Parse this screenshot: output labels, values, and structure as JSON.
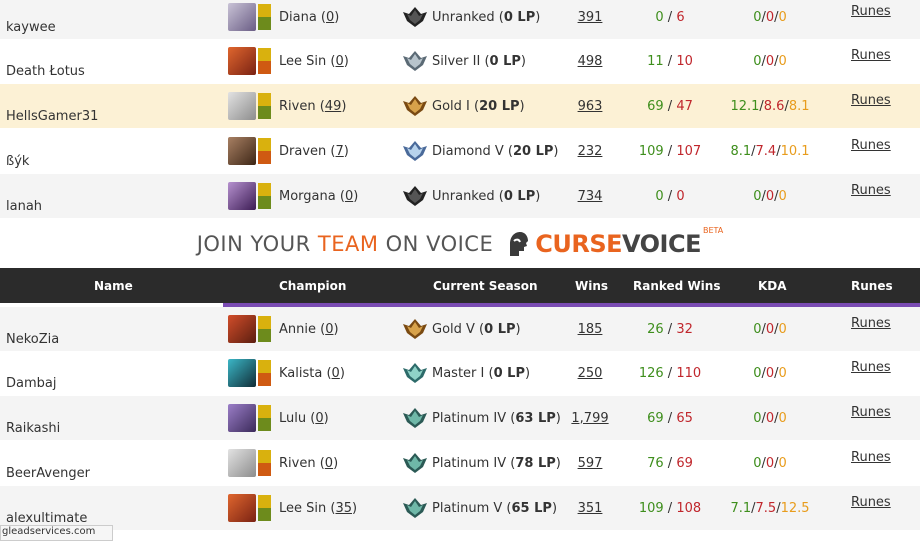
{
  "colors": {
    "wins": "#3e8e1c",
    "losses": "#c0262c",
    "assists": "#e89c1c",
    "banner_accent": "#e9641f",
    "header_bg": "#2b2b2b",
    "highlight": "#fcf1d5",
    "purple_bar": "#7a4bb3"
  },
  "team1": [
    {
      "name": "kaywee",
      "champion": "Diana",
      "champ_games": "0",
      "portrait": "diana-portrait",
      "rank_icon": "unranked-icon",
      "rank": "Unranked",
      "lp": "0 LP",
      "wins": "391",
      "rw": "0",
      "rl": "6",
      "k": "0",
      "d": "0",
      "a": "0",
      "runes": "Runes"
    },
    {
      "name": "Death Łotus",
      "champion": "Lee Sin",
      "champ_games": "0",
      "portrait": "lee-sin-portrait",
      "rank_icon": "silver-icon",
      "rank": "Silver II",
      "lp": "0 LP",
      "wins": "498",
      "rw": "11",
      "rl": "10",
      "k": "0",
      "d": "0",
      "a": "0",
      "runes": "Runes"
    },
    {
      "name": "HellsGamer31",
      "champion": "Riven",
      "champ_games": "49",
      "portrait": "riven-portrait",
      "rank_icon": "gold-icon",
      "rank": "Gold I",
      "lp": "20 LP",
      "wins": "963",
      "rw": "69",
      "rl": "47",
      "k": "12.1",
      "d": "8.6",
      "a": "8.1",
      "runes": "Runes"
    },
    {
      "name": "ßýk",
      "champion": "Draven",
      "champ_games": "7",
      "portrait": "draven-portrait",
      "rank_icon": "diamond-icon",
      "rank": "Diamond V",
      "lp": "20 LP",
      "wins": "232",
      "rw": "109",
      "rl": "107",
      "k": "8.1",
      "d": "7.4",
      "a": "10.1",
      "runes": "Runes"
    },
    {
      "name": "lanah",
      "champion": "Morgana",
      "champ_games": "0",
      "portrait": "morgana-portrait",
      "rank_icon": "unranked-icon",
      "rank": "Unranked",
      "lp": "0 LP",
      "wins": "734",
      "rw": "0",
      "rl": "0",
      "k": "0",
      "d": "0",
      "a": "0",
      "runes": "Runes"
    }
  ],
  "banner": {
    "join": "JOIN YOUR",
    "team": "TEAM",
    "on_voice": "ON VOICE",
    "curse": "CURSE",
    "voice": "VOICE",
    "beta": "BETA"
  },
  "header": {
    "name": "Name",
    "champion": "Champion",
    "season": "Current Season",
    "wins": "Wins",
    "ranked_wins": "Ranked Wins",
    "kda": "KDA",
    "runes": "Runes"
  },
  "team2": [
    {
      "name": "NekoZia",
      "champion": "Annie",
      "champ_games": "0",
      "portrait": "annie-portrait",
      "rank_icon": "gold-icon",
      "rank": "Gold V",
      "lp": "0 LP",
      "wins": "185",
      "rw": "26",
      "rl": "32",
      "k": "0",
      "d": "0",
      "a": "0",
      "runes": "Runes"
    },
    {
      "name": "Dambaj",
      "champion": "Kalista",
      "champ_games": "0",
      "portrait": "kalista-portrait",
      "rank_icon": "master-icon",
      "rank": "Master I",
      "lp": "0 LP",
      "wins": "250",
      "rw": "126",
      "rl": "110",
      "k": "0",
      "d": "0",
      "a": "0",
      "runes": "Runes"
    },
    {
      "name": "Raikashi",
      "champion": "Lulu",
      "champ_games": "0",
      "portrait": "lulu-portrait",
      "rank_icon": "platinum-icon",
      "rank": "Platinum IV",
      "lp": "63 LP",
      "wins": "1,799",
      "rw": "69",
      "rl": "65",
      "k": "0",
      "d": "0",
      "a": "0",
      "runes": "Runes"
    },
    {
      "name": "BeerAvenger",
      "champion": "Riven",
      "champ_games": "0",
      "portrait": "riven-portrait",
      "rank_icon": "platinum-icon",
      "rank": "Platinum IV",
      "lp": "78 LP",
      "wins": "597",
      "rw": "76",
      "rl": "69",
      "k": "0",
      "d": "0",
      "a": "0",
      "runes": "Runes"
    },
    {
      "name": "alexultimate",
      "champion": "Lee Sin",
      "champ_games": "35",
      "portrait": "lee-sin-portrait",
      "rank_icon": "platinum-icon",
      "rank": "Platinum V",
      "lp": "65 LP",
      "wins": "351",
      "rw": "109",
      "rl": "108",
      "k": "7.1",
      "d": "7.5",
      "a": "12.5",
      "runes": "Runes"
    }
  ],
  "status_url": "gleadservices.com"
}
